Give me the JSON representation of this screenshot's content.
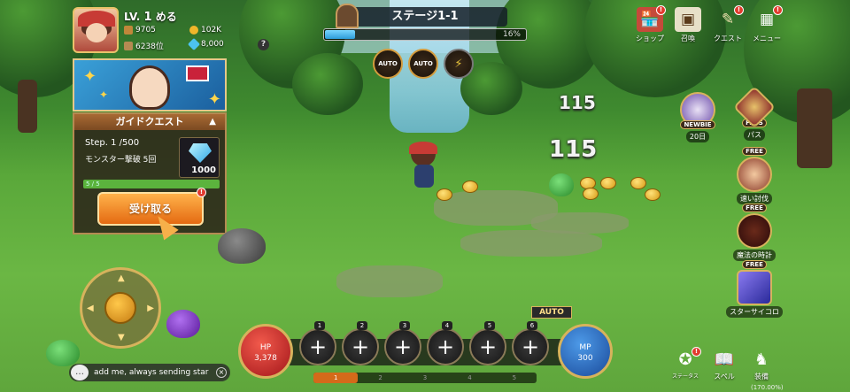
{
  "player": {
    "level_prefix": "LV.",
    "level": "1",
    "name": "める",
    "power": "9705",
    "rank": "6238位",
    "gold": "102K",
    "gems": "8,000",
    "help": "?"
  },
  "stage": {
    "title": "ステージ1-1",
    "progress": 16,
    "progress_label": "16%"
  },
  "auto_buttons": [
    {
      "label": "AUTO"
    },
    {
      "label": "AUTO"
    },
    {
      "label": "⚡"
    }
  ],
  "top_menu": [
    {
      "label": "ショップ",
      "icon": "shop-icon",
      "badge": "!"
    },
    {
      "label": "召喚",
      "icon": "summon-chest-icon",
      "badge": ""
    },
    {
      "label": "クエスト",
      "icon": "quest-scroll-icon",
      "badge": "!"
    },
    {
      "label": "メニュー",
      "icon": "menu-grid-icon",
      "badge": "!"
    }
  ],
  "guide_quest": {
    "title": "ガイドクエスト",
    "step": "Step. 1 /500",
    "description": "モンスター撃破 5回",
    "reward_amount": "1000",
    "progress_text": "5 / 5",
    "claim_label": "受け取る",
    "badge": "!"
  },
  "events": {
    "newbie": {
      "tag": "NEWBIE",
      "label": "20日"
    },
    "pass": {
      "tag": "PASS",
      "label": "パス"
    },
    "side": [
      {
        "free": "FREE",
        "label": "速い討伐"
      },
      {
        "free": "FREE",
        "label": "魔法の時計"
      },
      {
        "free": "FREE",
        "label": "スターサイコロ"
      }
    ]
  },
  "damage": [
    "115",
    "115"
  ],
  "hp": {
    "label": "HP",
    "value": "3,378"
  },
  "mp": {
    "label": "MP",
    "value": "300"
  },
  "skill_slots": [
    "1",
    "2",
    "3",
    "4",
    "5",
    "6"
  ],
  "skill_slot_symbol": "+",
  "auto_label": "AUTO",
  "pages": [
    "1",
    "2",
    "3",
    "4",
    "5"
  ],
  "chat": {
    "message": "add me, always sending star",
    "close": "×"
  },
  "bottom_menu": [
    {
      "label": "ステータス",
      "icon": "status-icon",
      "badge": "!"
    },
    {
      "label": "スペル",
      "icon": "spellbook-icon",
      "badge": ""
    },
    {
      "label": "装備",
      "icon": "equipment-icon",
      "badge": ""
    }
  ],
  "combat_power": "(170.00%)"
}
